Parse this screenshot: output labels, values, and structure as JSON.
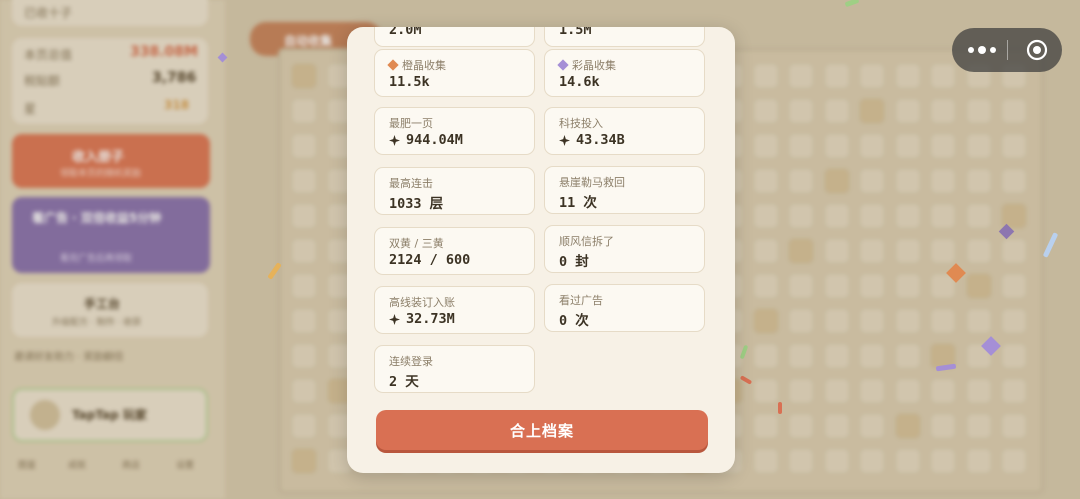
{
  "background": {
    "sidebar": {
      "top_label": "已收十子",
      "rows": [
        {
          "label": "本页总值",
          "value": "338.08M"
        },
        {
          "label": "税贴额",
          "value": "3,786"
        },
        {
          "label": "星",
          "value": "318"
        }
      ],
      "buttons": [
        {
          "title": "收入册子",
          "subtitle": "领取本页的随机奖励"
        },
        {
          "title": "看广告 · 双倍收益5分钟",
          "subtitle": "看完广告后再领取"
        },
        {
          "title": "手工台",
          "subtitle": "升级配方 · 制作 · 收获"
        }
      ],
      "hint": "邀请好友助力 · 奖励翻倍",
      "taptap_label": "TapTap 玩家",
      "bottom_tabs": [
        "图鉴",
        "成就",
        "商店",
        "设置"
      ]
    },
    "top_tag": "自动收集"
  },
  "capsule": {
    "menu_icon": "more-dots-icon",
    "close_icon": "record-target-icon"
  },
  "colors": {
    "accent": "#d97053",
    "orange_gem": "#e08a52",
    "purple_gem": "#a58fd6"
  },
  "modal": {
    "partial_top": [
      "2.0M",
      "1.5M"
    ],
    "stats": [
      {
        "label": "橙晶收集",
        "value": "11.5k",
        "icon": "orange-diamond-icon"
      },
      {
        "label": "彩晶收集",
        "value": "14.6k",
        "icon": "purple-diamond-icon"
      },
      {
        "label": "最肥一页",
        "value": "944.04M",
        "icon": "sparkle-icon"
      },
      {
        "label": "科技投入",
        "value": "43.34B",
        "icon": "sparkle-icon"
      },
      {
        "label": "最高连击",
        "value": "1033 层",
        "icon": ""
      },
      {
        "label": "悬崖勒马救回",
        "value": "11 次",
        "icon": ""
      },
      {
        "label": "双黄 / 三黄",
        "value": "2124 / 600",
        "icon": ""
      },
      {
        "label": "顺风信拆了",
        "value": "0 封",
        "icon": ""
      },
      {
        "label": "高线装订入账",
        "value": "32.73M",
        "icon": "sparkle-icon"
      },
      {
        "label": "看过广告",
        "value": "0 次",
        "icon": ""
      },
      {
        "label": "连续登录",
        "value": "2 天",
        "icon": ""
      }
    ],
    "close_label": "合上档案"
  }
}
